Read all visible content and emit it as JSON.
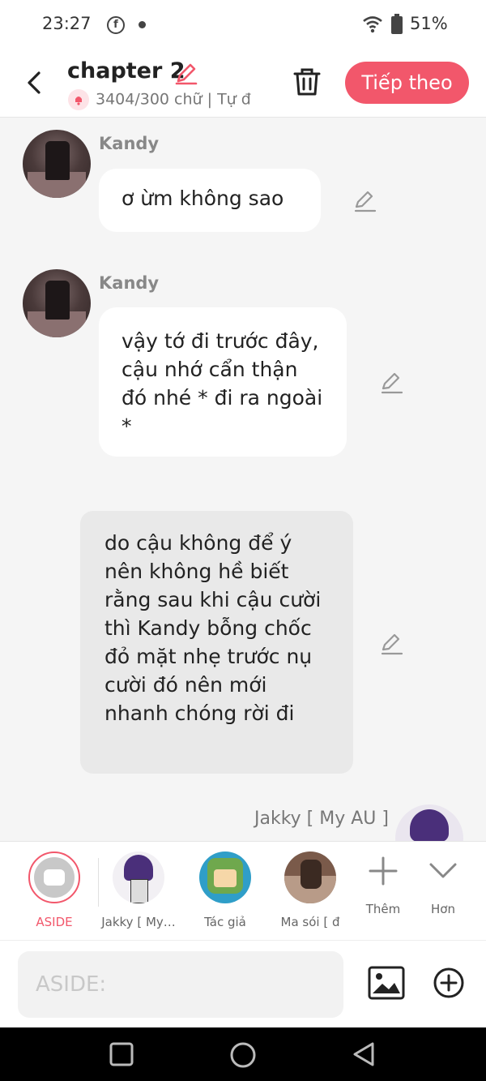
{
  "status_bar": {
    "time": "23:27",
    "battery": "51%",
    "fb_glyph": "f"
  },
  "header": {
    "title": "chapter 2",
    "subtitle": "3404/300 chữ | Tự đ",
    "next_button": "Tiếp theo"
  },
  "messages": [
    {
      "type": "character",
      "speaker": "Kandy",
      "text": "ơ ừm không sao"
    },
    {
      "type": "character",
      "speaker": "Kandy",
      "text": "vậy tớ đi trước đây, cậu nhớ cẩn thận đó nhé * đi ra ngoài *"
    },
    {
      "type": "aside",
      "text": "do cậu không để ý nên không hề biết rằng sau khi cậu cười thì Kandy bỗng chốc đỏ mặt nhẹ trước nụ cười đó nên mới nhanh chóng rời đi"
    },
    {
      "type": "character",
      "speaker": "Jakky [ My AU ]",
      "text": ""
    }
  ],
  "character_bar": {
    "items": [
      {
        "label": "ASIDE",
        "selected": true
      },
      {
        "label": "Jakky [ My…"
      },
      {
        "label": "Tác giả"
      },
      {
        "label": "Ma sói [ đ"
      }
    ],
    "add_label": "Thêm",
    "more_label": "Hơn"
  },
  "input": {
    "placeholder": "ASIDE:"
  },
  "colors": {
    "accent": "#f2576b",
    "aside_bubble": "#e9e9e9",
    "background": "#f5f5f5"
  }
}
